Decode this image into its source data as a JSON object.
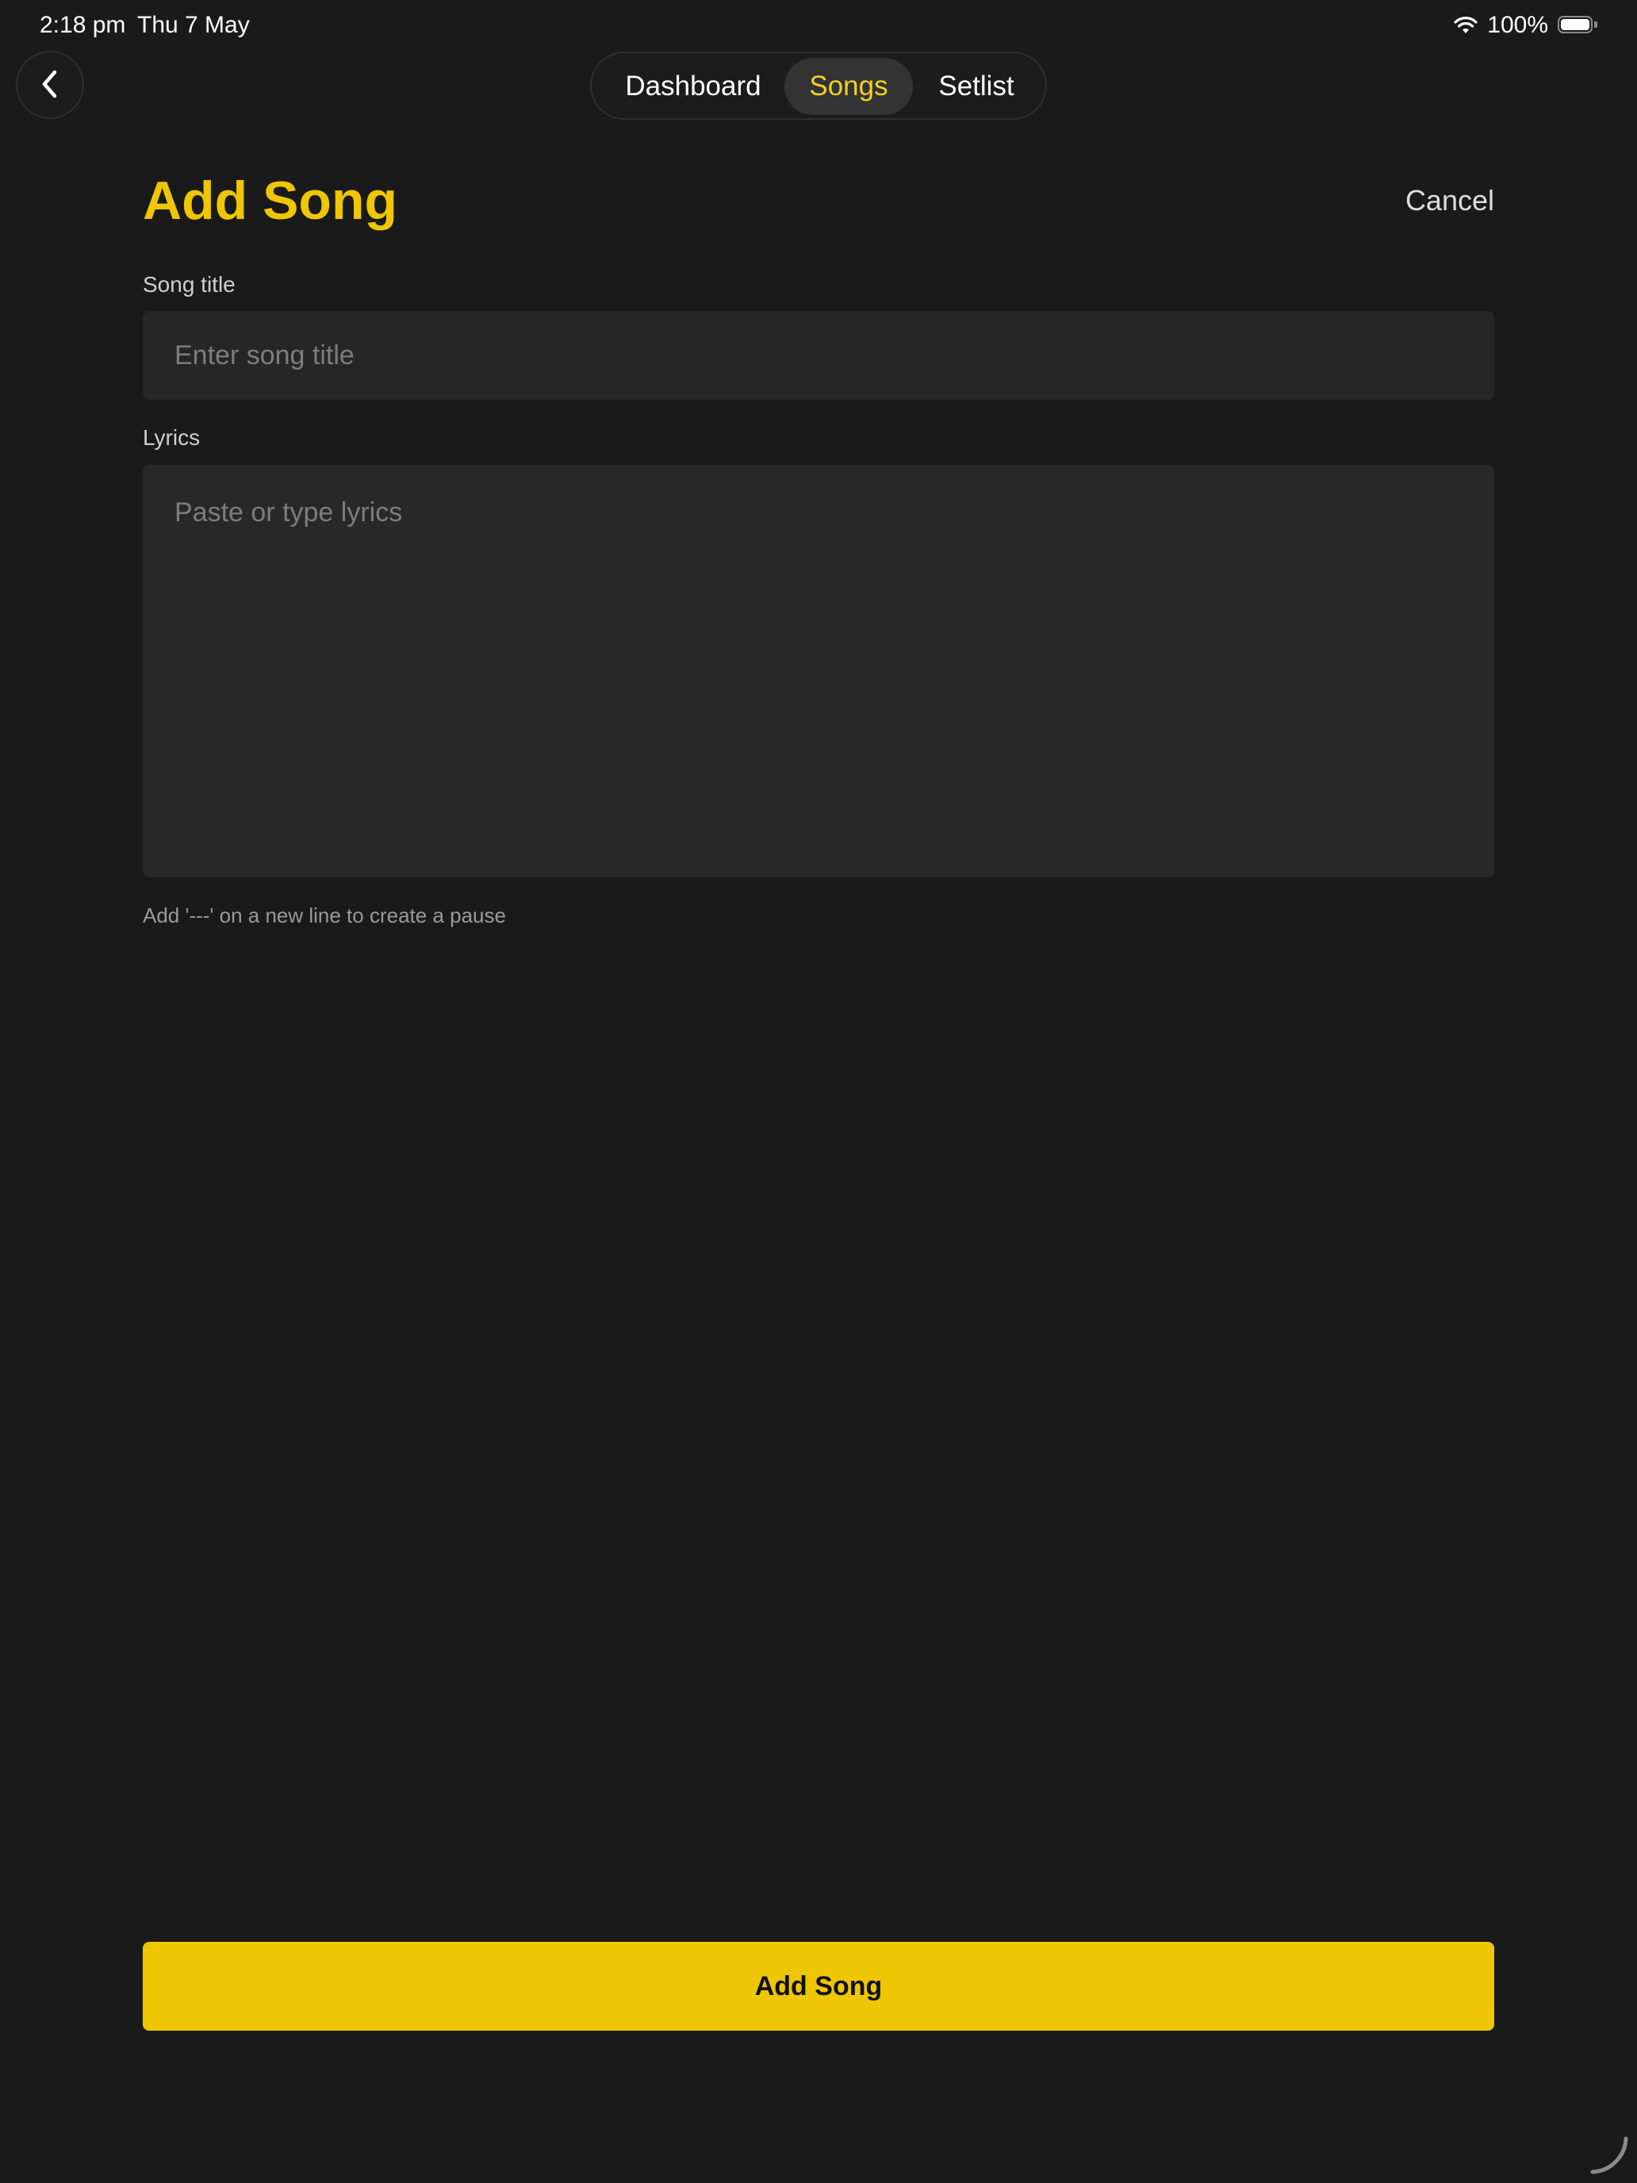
{
  "status_bar": {
    "time": "2:18 pm",
    "date": "Thu 7 May",
    "battery_percent": "100%",
    "battery_level": 1.0,
    "icons": [
      "wifi-icon",
      "battery-icon"
    ]
  },
  "nav": {
    "back_icon": "chevron-left-icon",
    "tabs": [
      {
        "label": "Dashboard",
        "selected": false
      },
      {
        "label": "Songs",
        "selected": true
      },
      {
        "label": "Setlist",
        "selected": false
      }
    ]
  },
  "header": {
    "title": "Add Song",
    "cancel_label": "Cancel"
  },
  "form": {
    "title_label": "Song title",
    "title_value": "",
    "title_placeholder": "Enter song title",
    "lyrics_label": "Lyrics",
    "lyrics_value": "",
    "lyrics_placeholder": "Paste or type lyrics",
    "helper": "Add '---' on a new line to create a pause",
    "submit_label": "Add Song"
  },
  "colors": {
    "background": "#1a1a1a",
    "accent": "#eec603",
    "selected_tab_text": "#f2d024",
    "field_background": "#262626"
  }
}
